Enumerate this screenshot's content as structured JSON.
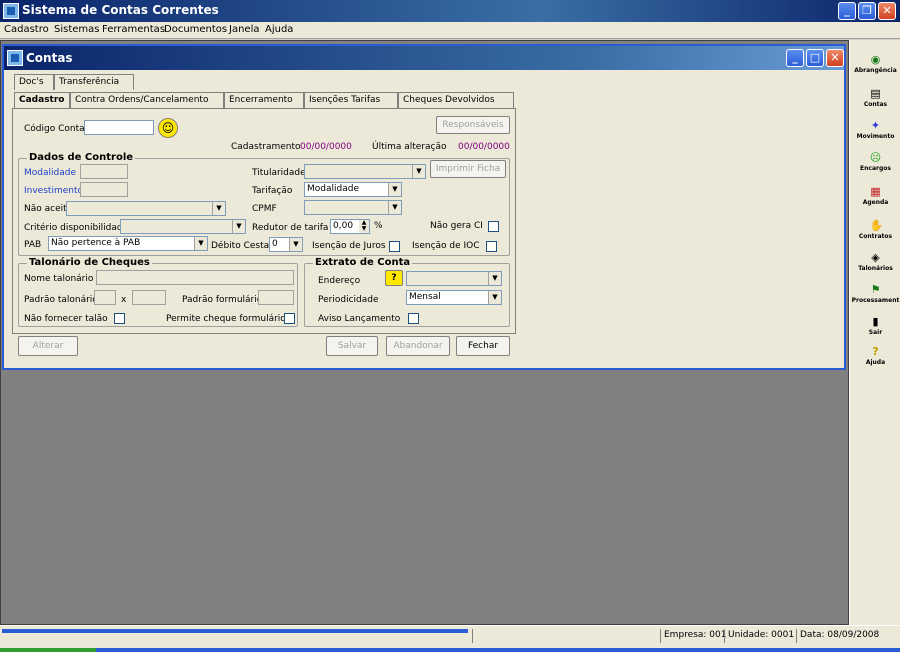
{
  "app": {
    "title": "Sistema de Contas Correntes"
  },
  "menu": [
    "Cadastro",
    "Sistemas",
    "Ferramentas",
    "Documentos",
    "Janela",
    "Ajuda"
  ],
  "child": {
    "title": "Contas"
  },
  "tabs": {
    "row1": [
      "Doc's",
      "Transferência"
    ],
    "row2": [
      "Cadastro",
      "Contra Ordens/Cancelamento",
      "Encerramento",
      "Isenções Tarifas",
      "Cheques Devolvidos"
    ]
  },
  "form": {
    "codigo_conta": "Código Conta",
    "responsaveis": "Responsáveis",
    "cadastramento_label": "Cadastramento",
    "cadastramento_value": "00/00/0000",
    "ultima_alteracao_label": "Última alteração",
    "ultima_alteracao_value": "00/00/0000"
  },
  "dados": {
    "title": "Dados de Controle",
    "modalidade": "Modalidade",
    "investimento": "Investimento",
    "nao_aceitar": "Não aceitar",
    "criterio": "Critério disponibilidade",
    "pab": "PAB",
    "pab_value": "Não pertence à PAB",
    "titularidade": "Titularidade",
    "tarifacao": "Tarifação",
    "tarifacao_value": "Modalidade",
    "cpmf": "CPMF",
    "redutor": "Redutor de tarifa",
    "redutor_value": "0,00",
    "percent": "%",
    "debito_cesta": "Débito Cesta",
    "debito_cesta_value": "0",
    "isencao_juros": "Isenção de Juros",
    "nao_gera_ci": "Não gera CI",
    "isencao_ioc": "Isenção de IOC",
    "imprimir_ficha": "Imprimir Ficha"
  },
  "talonario": {
    "title": "Talonário de Cheques",
    "nome": "Nome talonário",
    "padrao": "Padrão talonário",
    "x": "x",
    "padrao_formulario": "Padrão formulário",
    "nao_fornecer": "Não fornecer talão",
    "permite": "Permite cheque formulário"
  },
  "extrato": {
    "title": "Extrato de Conta",
    "endereco": "Endereço",
    "periodicidade": "Periodicidade",
    "periodicidade_value": "Mensal",
    "aviso": "Aviso Lançamento"
  },
  "buttons": {
    "alterar": "Alterar",
    "salvar": "Salvar",
    "abandonar": "Abandonar",
    "fechar": "Fechar"
  },
  "toolbar": [
    {
      "label": "Abrangência",
      "icon": "globe-icon"
    },
    {
      "label": "Contas",
      "icon": "accounts-icon"
    },
    {
      "label": "Movimento",
      "icon": "runner-icon"
    },
    {
      "label": "Encargos",
      "icon": "smiley-icon"
    },
    {
      "label": "Agenda",
      "icon": "calendar-icon"
    },
    {
      "label": "Contratos",
      "icon": "handshake-icon"
    },
    {
      "label": "Talonários",
      "icon": "checkbook-icon"
    },
    {
      "label": "Processament",
      "icon": "flag-icon"
    },
    {
      "label": "Sair",
      "icon": "exit-icon"
    },
    {
      "label": "Ajuda",
      "icon": "help-icon"
    }
  ],
  "status": {
    "empresa": "Empresa: 001",
    "unidade": "Unidade: 0001",
    "data": "Data:  08/09/2008"
  }
}
